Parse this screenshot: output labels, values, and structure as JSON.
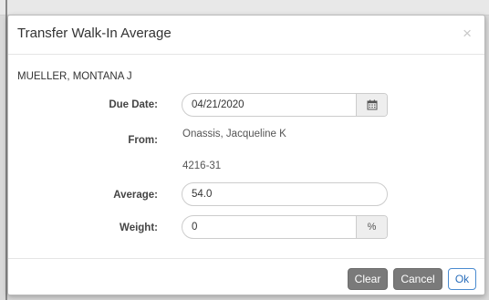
{
  "modal": {
    "title": "Transfer Walk-In Average",
    "close_label": "×",
    "student_name": "MUELLER, MONTANA J"
  },
  "form": {
    "due_date_label": "Due Date:",
    "due_date_value": "04/21/2020",
    "from_label": "From:",
    "from_teacher": "Onassis, Jacqueline K",
    "from_course": "4216-31",
    "average_label": "Average:",
    "average_value": "54.0",
    "weight_label": "Weight:",
    "weight_value": "0",
    "weight_addon": "%"
  },
  "footer": {
    "clear_label": "Clear",
    "cancel_label": "Cancel",
    "ok_label": "Ok"
  },
  "icons": {
    "calendar": "calendar-icon"
  },
  "colors": {
    "ok_border": "#4a8bd0",
    "gray_button": "#7a7a7a"
  }
}
